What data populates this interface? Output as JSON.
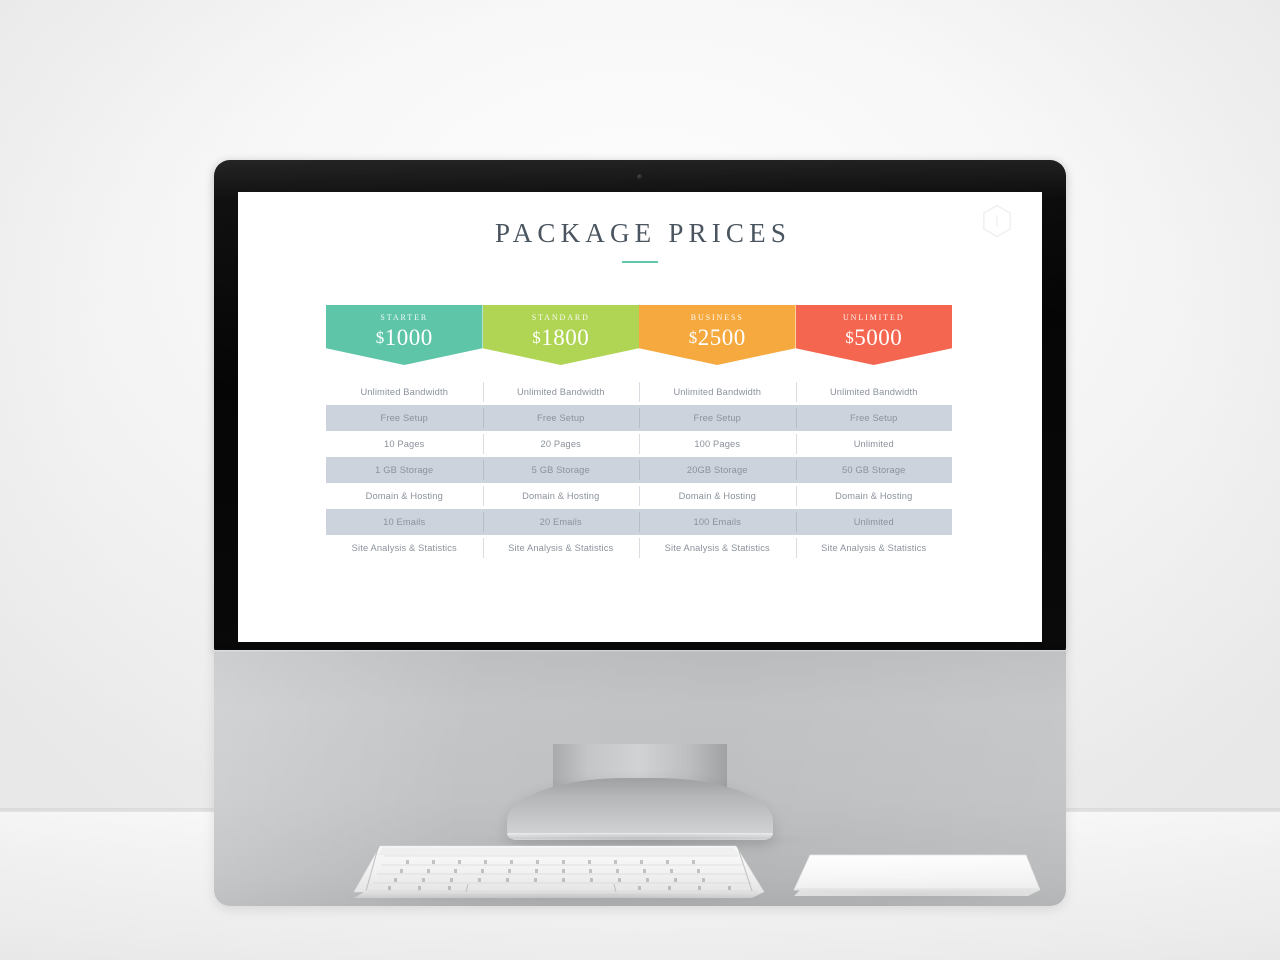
{
  "scene": {
    "device": "desktop-monitor-mockup",
    "peripherals": [
      "keyboard",
      "trackpad"
    ]
  },
  "slide": {
    "title": "PACKAGE  PRICES",
    "logo_icon": "hexagon-logo-icon"
  },
  "pricing": {
    "plans": [
      {
        "name": "STARTER",
        "currency": "$",
        "price": "1000",
        "color": "#5ec5a8",
        "features": [
          "Unlimited Bandwidth",
          "Free Setup",
          "10 Pages",
          "1 GB Storage",
          "Domain & Hosting",
          "10 Emails",
          "Site Analysis & Statistics"
        ]
      },
      {
        "name": "STANDARD",
        "currency": "$",
        "price": "1800",
        "color": "#b0d454",
        "features": [
          "Unlimited Bandwidth",
          "Free Setup",
          "20 Pages",
          "5 GB Storage",
          "Domain & Hosting",
          "20 Emails",
          "Site Analysis & Statistics"
        ]
      },
      {
        "name": "BUSINESS",
        "currency": "$",
        "price": "2500",
        "color": "#f6a93f",
        "features": [
          "Unlimited Bandwidth",
          "Free Setup",
          "100 Pages",
          "20GB Storage",
          "Domain & Hosting",
          "100 Emails",
          "Site Analysis & Statistics"
        ]
      },
      {
        "name": "UNLIMITED",
        "currency": "$",
        "price": "5000",
        "color": "#f56650",
        "features": [
          "Unlimited Bandwidth",
          "Free Setup",
          "Unlimited",
          "50 GB Storage",
          "Domain & Hosting",
          "Unlimited",
          "Site Analysis & Statistics"
        ]
      }
    ],
    "row_stripe_color": "#ccd3dc",
    "feature_text_color": "#8b929b",
    "accent_rule_color": "#63c6aa",
    "title_color": "#4a5560"
  }
}
